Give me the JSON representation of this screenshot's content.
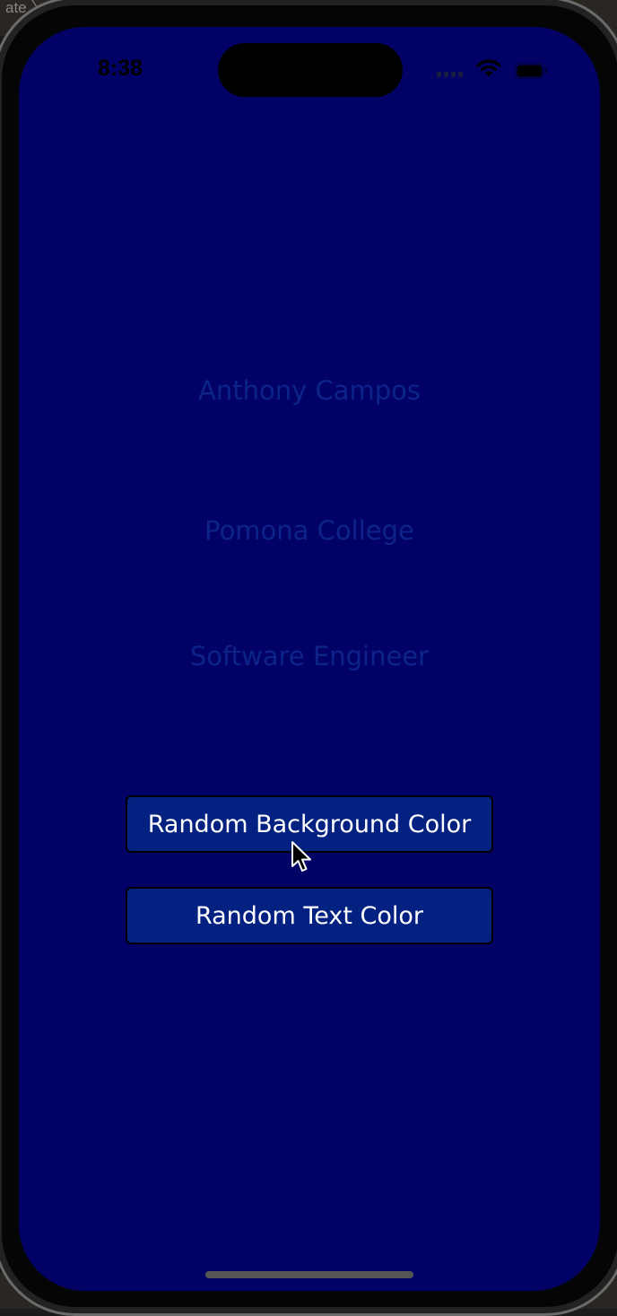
{
  "window": {
    "breadcrumb": "ate 〉 N"
  },
  "status_bar": {
    "time": "8:38",
    "icons": [
      "cellular-signal-icon",
      "wifi-icon",
      "battery-icon"
    ]
  },
  "content": {
    "name": "Anthony Campos",
    "college": "Pomona College",
    "role": "Software Engineer"
  },
  "buttons": {
    "random_background_label": "Random Background Color",
    "random_text_label": "Random Text Color"
  },
  "colors": {
    "background": "#020266",
    "text": "#0c2489",
    "button_background": "#032181",
    "button_text": "#ffffff"
  },
  "icons": {
    "pointer": "mouse-pointer-icon"
  }
}
